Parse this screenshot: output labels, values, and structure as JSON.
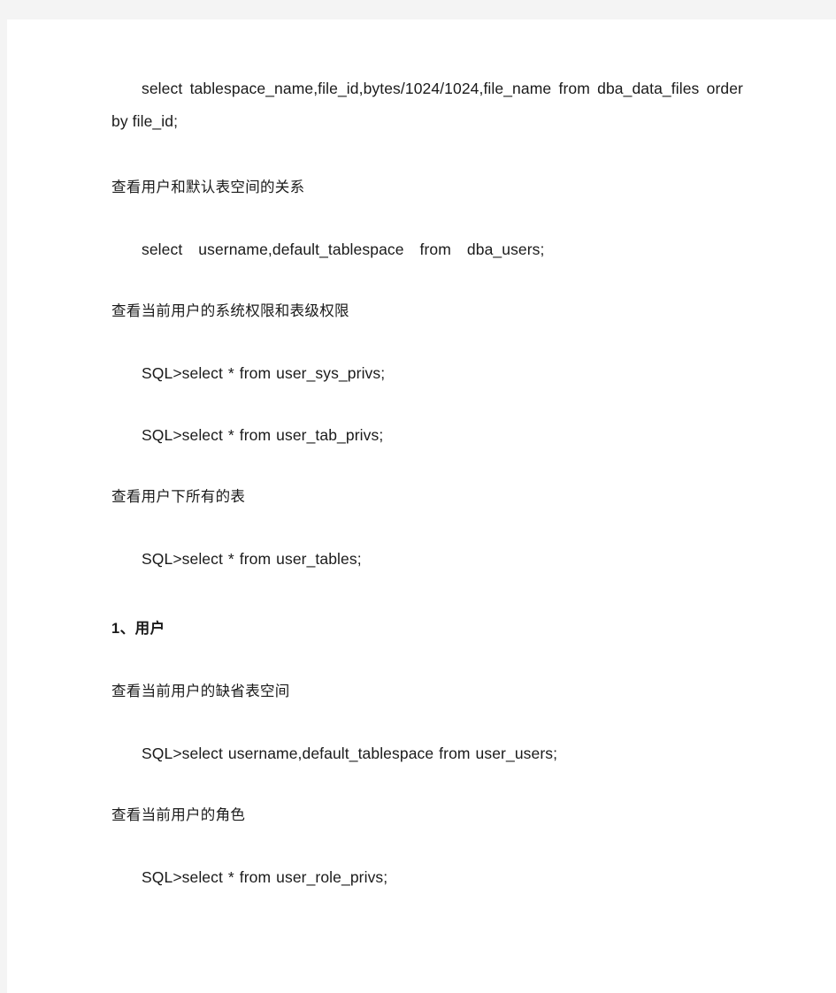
{
  "document": {
    "page_background": "#f4f4f4",
    "sheet_background": "#ffffff",
    "text_color": "#1a1a1a",
    "blocks": [
      {
        "id": "b1",
        "type": "code",
        "text": "select tablespace_name,file_id,bytes/1024/1024,file_name from dba_data_files order by file_id;"
      },
      {
        "id": "b2",
        "type": "chinese-label",
        "text": "查看用户和默认表空间的关系"
      },
      {
        "id": "b3",
        "type": "code",
        "text": "select username,default_tablespace from dba_users;"
      },
      {
        "id": "b4",
        "type": "chinese-label",
        "text": "查看当前用户的系统权限和表级权限"
      },
      {
        "id": "b5",
        "type": "code",
        "text": "SQL>select * from user_sys_privs;"
      },
      {
        "id": "b6",
        "type": "code",
        "text": "SQL>select * from user_tab_privs;"
      },
      {
        "id": "b7",
        "type": "chinese-label",
        "text": "查看用户下所有的表"
      },
      {
        "id": "b8",
        "type": "code",
        "text": "SQL>select * from user_tables;"
      },
      {
        "id": "b9",
        "type": "heading",
        "text": "1、用户"
      },
      {
        "id": "b10",
        "type": "chinese-label",
        "text": "查看当前用户的缺省表空间"
      },
      {
        "id": "b11",
        "type": "code",
        "text": "SQL>select username,default_tablespace from user_users;"
      },
      {
        "id": "b12",
        "type": "chinese-label",
        "text": "查看当前用户的角色"
      },
      {
        "id": "b13",
        "type": "code",
        "text": "SQL>select * from user_role_privs;"
      }
    ]
  }
}
